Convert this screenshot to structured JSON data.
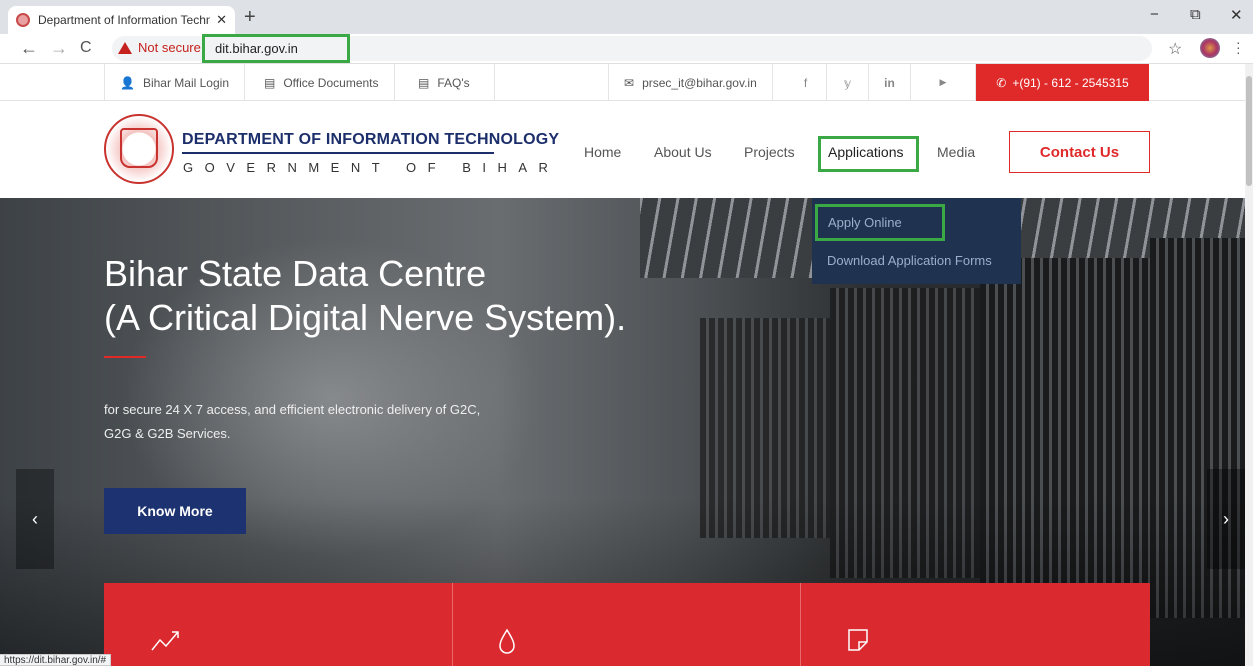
{
  "browser": {
    "tab_title": "Department of Information Techn",
    "tab_close": "✕",
    "new_tab": "+",
    "back": "←",
    "forward": "→",
    "reload": "C",
    "not_secure": "Not secure",
    "url": "dit.bihar.gov.in",
    "bookmark_star": "☆",
    "win_minimize": "−",
    "win_restore": "⧉",
    "win_close": "✕",
    "status_url": "https://dit.bihar.gov.in/#"
  },
  "topbar": {
    "mail_login": "Bihar Mail Login",
    "office_docs": "Office Documents",
    "faqs": "FAQ's",
    "email": "prsec_it@bihar.gov.in",
    "facebook": "f",
    "twitter": "𝕪",
    "linkedin": "in",
    "youtube": "▶",
    "phone": "+(91) - 612 - 2545315"
  },
  "header": {
    "dept_title": "DEPARTMENT OF INFORMATION TECHNOLOGY",
    "gov_line": "GOVERNMENT OF BIHAR",
    "menu": [
      "Home",
      "About Us",
      "Projects",
      "Applications",
      "Media"
    ],
    "contact": "Contact Us"
  },
  "dropdown": {
    "items": [
      "Apply Online",
      "Download Application Forms"
    ]
  },
  "hero": {
    "title_line1": "Bihar State Data Centre",
    "title_line2": "(A Critical Digital Nerve System).",
    "subtitle_line1": "for secure 24 X 7 access, and efficient electronic delivery of G2C,",
    "subtitle_line2": "G2G & G2B Services.",
    "cta": "Know More",
    "prev": "‹",
    "next": "›"
  },
  "features": {
    "icons": [
      "trend-icon",
      "drop-icon",
      "document-icon"
    ]
  },
  "colors": {
    "brand_red": "#da2a2f",
    "brand_navy": "#1d3270",
    "highlight_green": "#3aa845"
  }
}
